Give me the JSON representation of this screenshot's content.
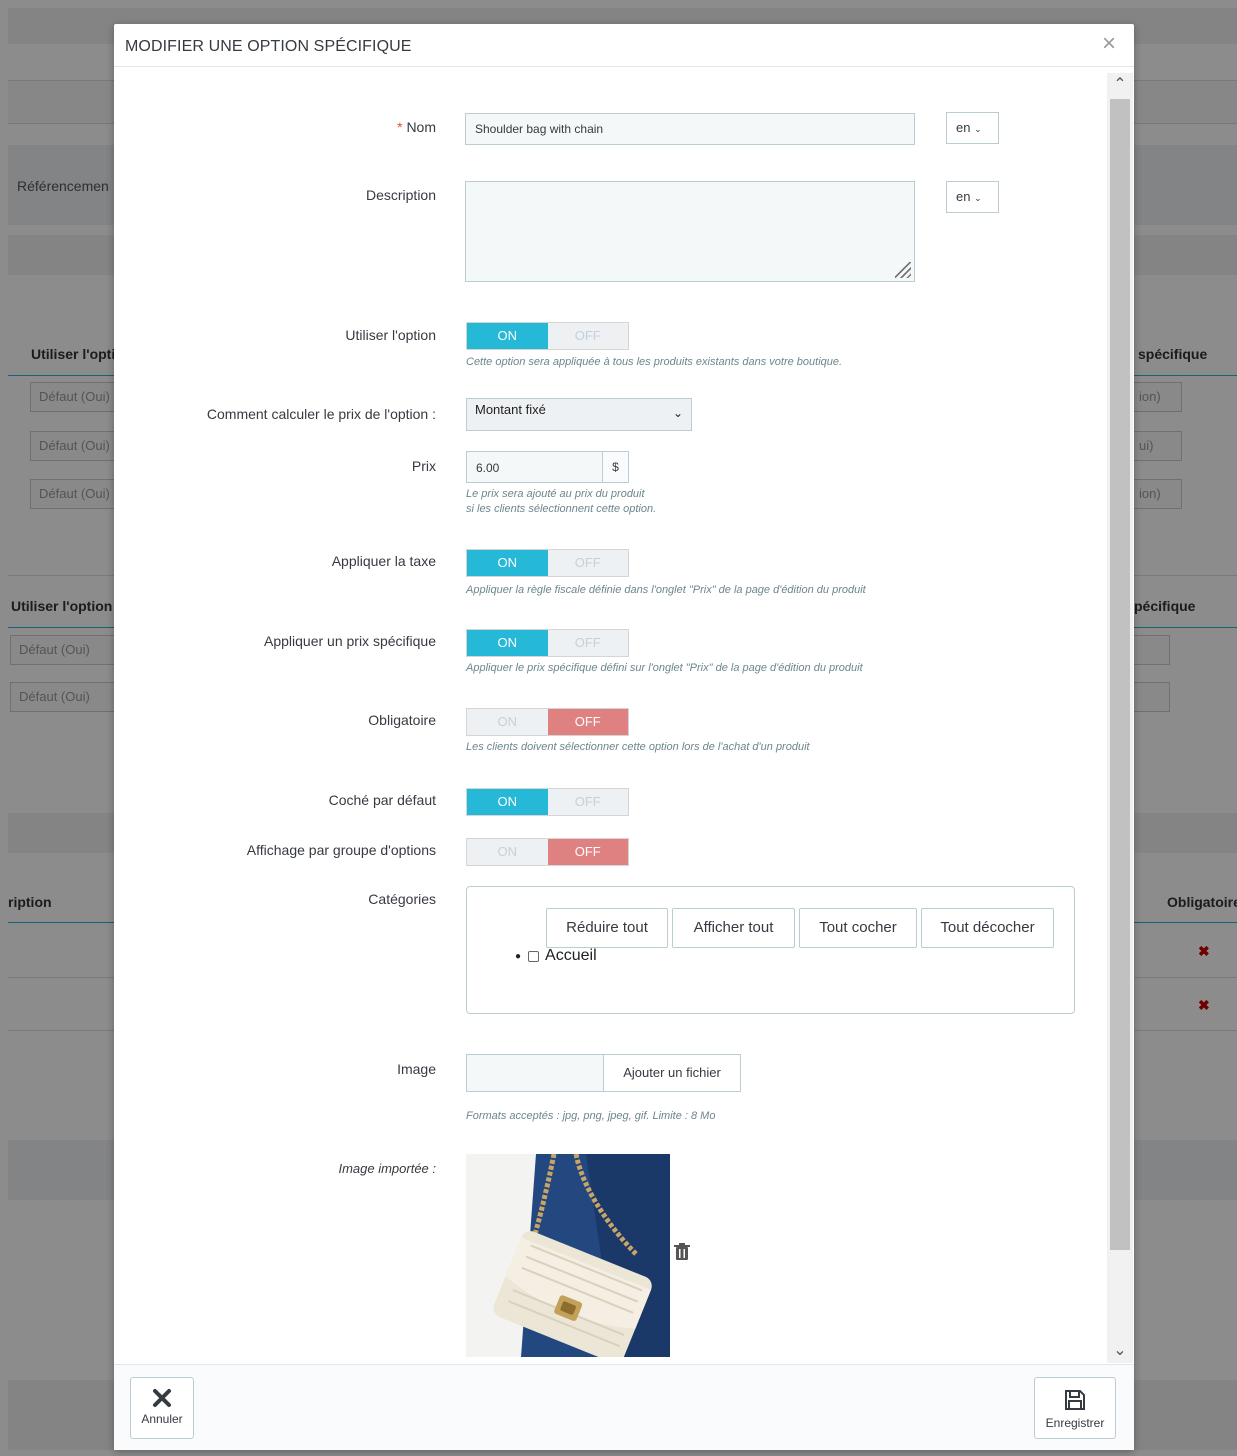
{
  "background": {
    "section_label": "Référencemen",
    "col_use_option": "Utiliser l'opti",
    "col_specific": "spécifique",
    "default_yes": "Défaut (Oui)",
    "default_no_partial": "ion)",
    "default_yes_partial": "ui)",
    "col_use_option_2": "Utiliser l'option",
    "col_specific_2": "pécifique",
    "col_description_partial": "ription",
    "col_required": "Obligatoire",
    "remove_mark": "✖"
  },
  "modal": {
    "title": "MODIFIER UNE OPTION SPÉCIFIQUE",
    "close": "×"
  },
  "form": {
    "name": {
      "required_mark": "*",
      "label": "Nom",
      "value": "Shoulder bag with chain",
      "lang": "en"
    },
    "description": {
      "label": "Description",
      "value": "",
      "lang": "en"
    },
    "use_option": {
      "label": "Utiliser l'option",
      "on": "ON",
      "off": "OFF",
      "value": true,
      "help": "Cette option sera appliquée à tous les produits existants dans votre boutique."
    },
    "price_calc": {
      "label": "Comment calculer le prix de l'option :",
      "selected": "Montant fixé"
    },
    "price": {
      "label": "Prix",
      "value": "6.00",
      "currency": "$",
      "help_line1": "Le prix sera ajouté au prix du produit",
      "help_line2": "si les clients sélectionnent cette option."
    },
    "apply_tax": {
      "label": "Appliquer la taxe",
      "on": "ON",
      "off": "OFF",
      "value": true,
      "help": "Appliquer la règle fiscale définie dans l'onglet \"Prix\" de la page d'édition du produit"
    },
    "apply_specific_price": {
      "label": "Appliquer un prix spécifique",
      "on": "ON",
      "off": "OFF",
      "value": true,
      "help": "Appliquer le prix spécifique défini sur l'onglet \"Prix\" de la page d'édition du produit"
    },
    "required": {
      "label": "Obligatoire",
      "on": "ON",
      "off": "OFF",
      "value": false,
      "help": "Les clients doivent sélectionner cette option lors de l'achat d'un produit"
    },
    "checked_default": {
      "label": "Coché par défaut",
      "on": "ON",
      "off": "OFF",
      "value": true
    },
    "display_by_group": {
      "label": "Affichage par groupe d'options",
      "on": "ON",
      "off": "OFF",
      "value": false
    },
    "categories": {
      "label": "Catégories",
      "collapse_all": "Réduire tout",
      "expand_all": "Afficher tout",
      "check_all": "Tout cocher",
      "uncheck_all": "Tout décocher",
      "items": [
        "Accueil"
      ]
    },
    "image": {
      "label": "Image",
      "add_file": "Ajouter un fichier",
      "help": "Formats acceptés : jpg, png, jpeg, gif. Limite : 8 Mo"
    },
    "uploaded_image": {
      "label": "Image importée :"
    }
  },
  "footer": {
    "cancel": "Annuler",
    "save": "Enregistrer"
  },
  "colors": {
    "switch_on": "#25b9d7",
    "switch_off": "#e08181"
  }
}
